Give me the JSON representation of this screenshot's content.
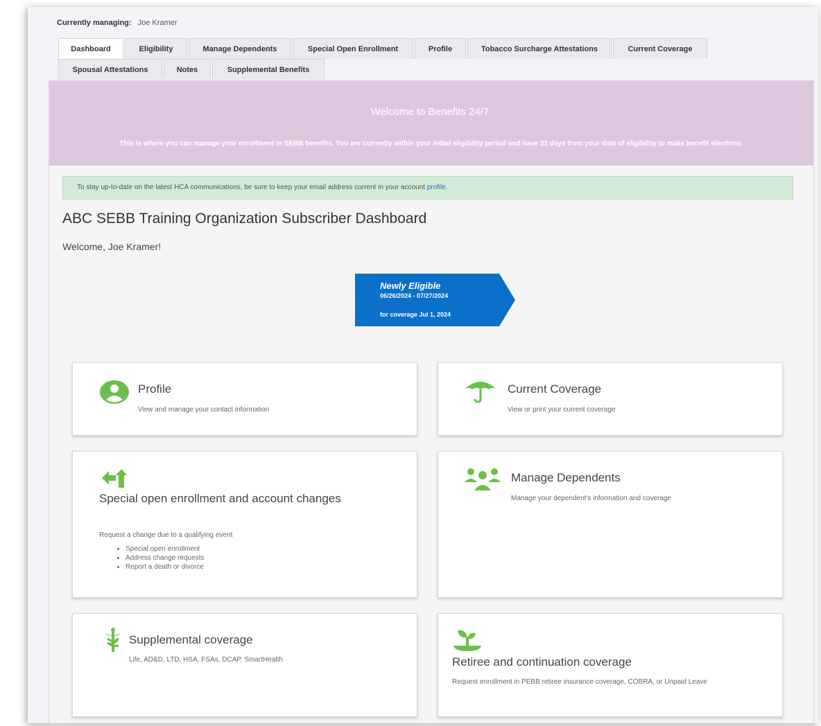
{
  "managing": {
    "label": "Currently managing:",
    "name": "Joe Kramer"
  },
  "tabs": [
    "Dashboard",
    "Eligibility",
    "Manage Dependents",
    "Special Open Enrollment",
    "Profile",
    "Tobacco Surcharge Attestations",
    "Current Coverage",
    "Spousal Attestations",
    "Notes",
    "Supplemental Benefits"
  ],
  "welcome": {
    "title": "Welcome to Benefits 24/7.",
    "message": "This is where you can manage your enrollment in SEBB benefits. You are currently within your initial eligibility period and have 31 days from your date of eligibility to make benefit elections."
  },
  "alert": {
    "text": "To stay up-to-date on the latest HCA communications, be sure to keep your email address current in your account ",
    "link": "profile."
  },
  "dashboard_title": "ABC SEBB Training Organization Subscriber Dashboard",
  "welcome_user": "Welcome, Joe Kramer!",
  "banner": {
    "title": "Newly Eligible",
    "dates": "06/26/2024 - 07/27/2024",
    "coverage": "for coverage Jul 1, 2024"
  },
  "cards": {
    "profile": {
      "title": "Profile",
      "desc": "View and manage your contact information"
    },
    "current_coverage": {
      "title": "Current Coverage",
      "desc": "View or print your current coverage"
    },
    "special": {
      "title": "Special open enrollment and account changes",
      "desc": "Request a change due to a qualifying event",
      "items": [
        "Special open enrollment",
        "Address change requests",
        "Report a death or divorce"
      ]
    },
    "dependents": {
      "title": "Manage Dependents",
      "desc": "Manage your dependent's information and coverage"
    },
    "supplemental": {
      "title": "Supplemental coverage",
      "desc": "Life, AD&D, LTD, HSA, FSAs, DCAP, SmartHealth"
    },
    "retiree": {
      "title": "Retiree and continuation coverage",
      "desc": "Request enrollment in PEBB retiree insurance coverage, COBRA, or Unpaid Leave"
    }
  },
  "colors": {
    "welcome_bg": "#dcc8dd",
    "alert_bg": "#d4ead6",
    "banner_blue": "#0b70c9",
    "icon_green": "#6cbf4b"
  },
  "icons": [
    "person-circle-icon",
    "umbrella-icon",
    "arrows-icon",
    "group-icon",
    "caduceus-icon",
    "sprout-icon"
  ]
}
